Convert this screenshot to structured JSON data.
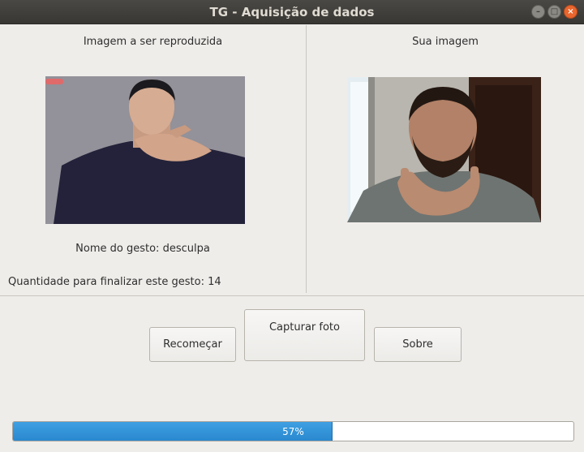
{
  "window": {
    "title": "TG - Aquisição de dados",
    "controls": {
      "minimize_icon": "minimize-icon",
      "maximize_icon": "maximize-icon",
      "close_icon": "close-icon"
    }
  },
  "left_panel": {
    "heading": "Imagem a ser reproduzida",
    "gesture_name": "Nome do gesto: desculpa",
    "remaining_count": "Quantidade para finalizar este gesto: 14"
  },
  "right_panel": {
    "heading": "Sua imagem"
  },
  "buttons": {
    "restart": "Recomeçar",
    "capture": "Capturar foto",
    "about": "Sobre"
  },
  "progress": {
    "value": 57,
    "label": "57%",
    "fill_color": "#2f8fd8"
  }
}
